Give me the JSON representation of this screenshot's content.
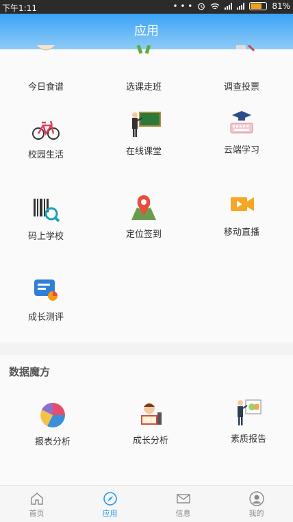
{
  "status": {
    "time": "下午1:11",
    "battery": "81%",
    "battery_level": 0.81,
    "dots": "• • •"
  },
  "header": {
    "title": "应用"
  },
  "apps": [
    {
      "label": "今日食谱",
      "icon": "recipe-icon"
    },
    {
      "label": "选课走班",
      "icon": "class-select-icon"
    },
    {
      "label": "调查投票",
      "icon": "vote-icon"
    },
    {
      "label": "校园生活",
      "icon": "bicycle-icon"
    },
    {
      "label": "在线课堂",
      "icon": "teacher-board-icon"
    },
    {
      "label": "云端学习",
      "icon": "graduation-keyboard-icon"
    },
    {
      "label": "码上学校",
      "icon": "barcode-scan-icon"
    },
    {
      "label": "定位签到",
      "icon": "map-pin-icon"
    },
    {
      "label": "移动直播",
      "icon": "video-camera-icon"
    },
    {
      "label": "成长测评",
      "icon": "chat-chart-icon"
    }
  ],
  "data_section": {
    "title": "数据魔方",
    "items": [
      {
        "label": "报表分析",
        "icon": "pie-chart-icon"
      },
      {
        "label": "成长分析",
        "icon": "student-reading-icon"
      },
      {
        "label": "素质报告",
        "icon": "presentation-icon"
      }
    ]
  },
  "tabs": [
    {
      "label": "首页",
      "icon": "home-icon"
    },
    {
      "label": "应用",
      "icon": "compass-icon",
      "active": true
    },
    {
      "label": "信息",
      "icon": "mail-icon"
    },
    {
      "label": "我的",
      "icon": "user-icon"
    }
  ],
  "colors": {
    "accent": "#2196f3",
    "header_top": "#3aa3f6",
    "header_bottom": "#8fcbf7"
  }
}
